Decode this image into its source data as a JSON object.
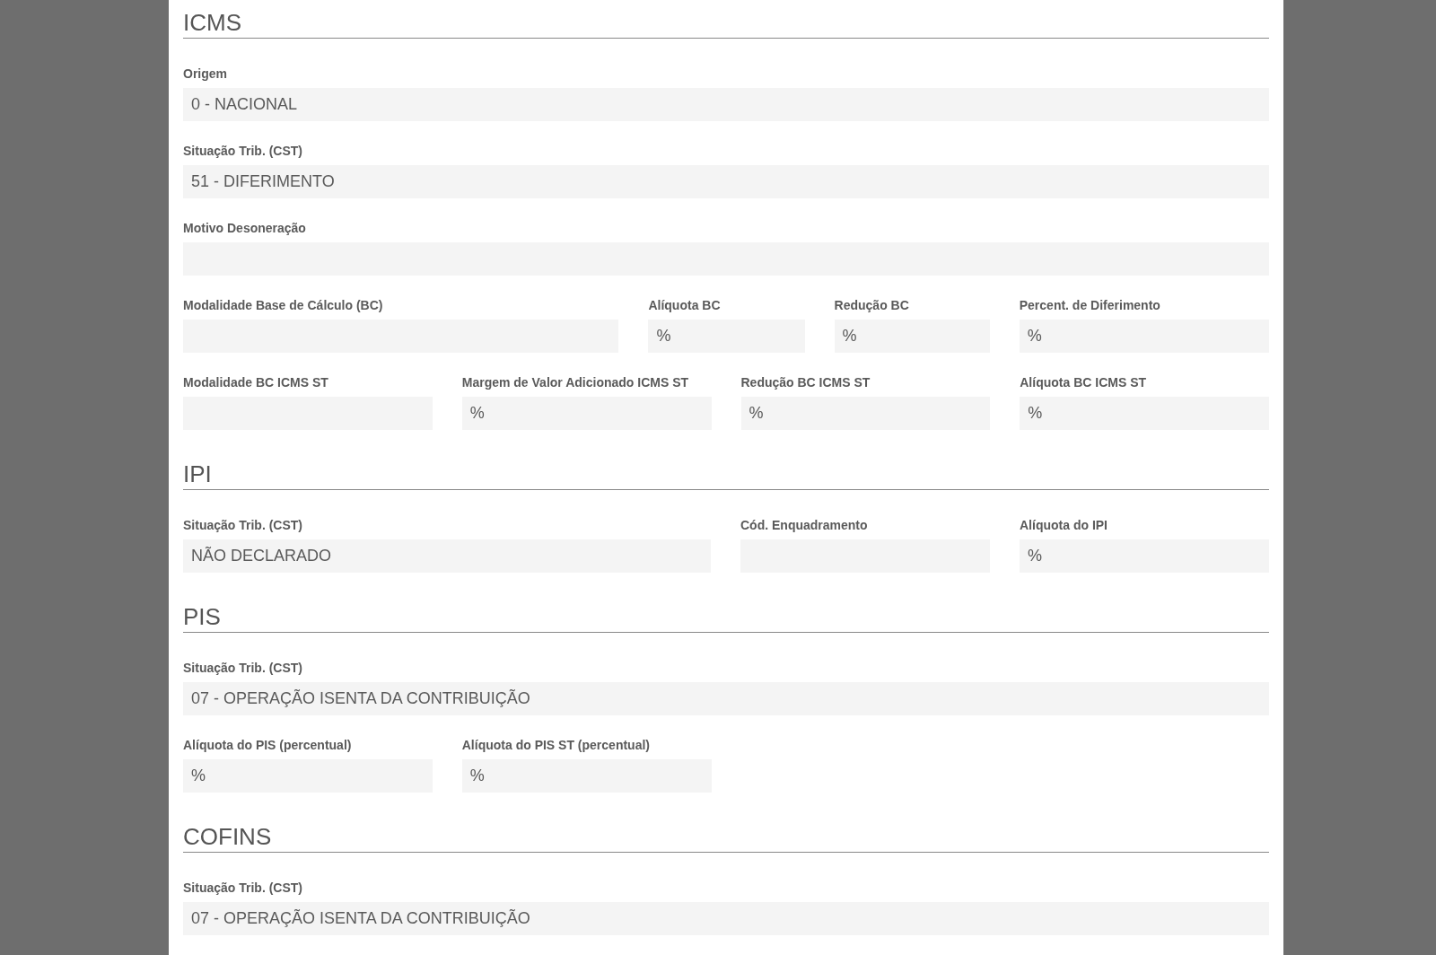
{
  "sections": [
    {
      "title": "ICMS",
      "rows": [
        {
          "fields": [
            {
              "label": "Origem",
              "value": "0 - NACIONAL"
            }
          ]
        },
        {
          "fields": [
            {
              "label": "Situação Trib. (CST)",
              "value": "51 - DIFERIMENTO"
            }
          ]
        },
        {
          "fields": [
            {
              "label": "Motivo Desoneração"
            }
          ]
        },
        {
          "fields": [
            {
              "label": "Modalidade Base de Cálculo (BC)"
            },
            {
              "label": "Alíquota BC",
              "unit": "%"
            },
            {
              "label": "Redução BC",
              "unit": "%"
            },
            {
              "label": "Percent. de Diferimento",
              "unit": "%"
            }
          ]
        },
        {
          "fields": [
            {
              "label": "Modalidade BC ICMS ST"
            },
            {
              "label": "Margem de Valor Adicionado ICMS ST",
              "unit": "%"
            },
            {
              "label": "Redução BC ICMS ST",
              "unit": "%"
            },
            {
              "label": "Alíquota BC ICMS ST",
              "unit": "%"
            }
          ]
        }
      ]
    },
    {
      "title": "IPI",
      "rows": [
        {
          "fields": [
            {
              "label": "Situação Trib. (CST)",
              "value": "NÃO DECLARADO"
            },
            {
              "label": "Cód. Enquadramento"
            },
            {
              "label": "Alíquota do IPI",
              "unit": "%"
            }
          ]
        }
      ]
    },
    {
      "title": "PIS",
      "rows": [
        {
          "fields": [
            {
              "label": "Situação Trib. (CST)",
              "value": "07 - OPERAÇÃO ISENTA DA CONTRIBUIÇÃO"
            }
          ]
        },
        {
          "fields": [
            {
              "label": "Alíquota do PIS (percentual)",
              "unit": "%"
            },
            {
              "label": "Alíquota do PIS ST (percentual)",
              "unit": "%"
            }
          ]
        }
      ]
    },
    {
      "title": "COFINS",
      "rows": [
        {
          "fields": [
            {
              "label": "Situação Trib. (CST)",
              "value": "07 - OPERAÇÃO ISENTA DA CONTRIBUIÇÃO"
            }
          ]
        }
      ]
    }
  ]
}
